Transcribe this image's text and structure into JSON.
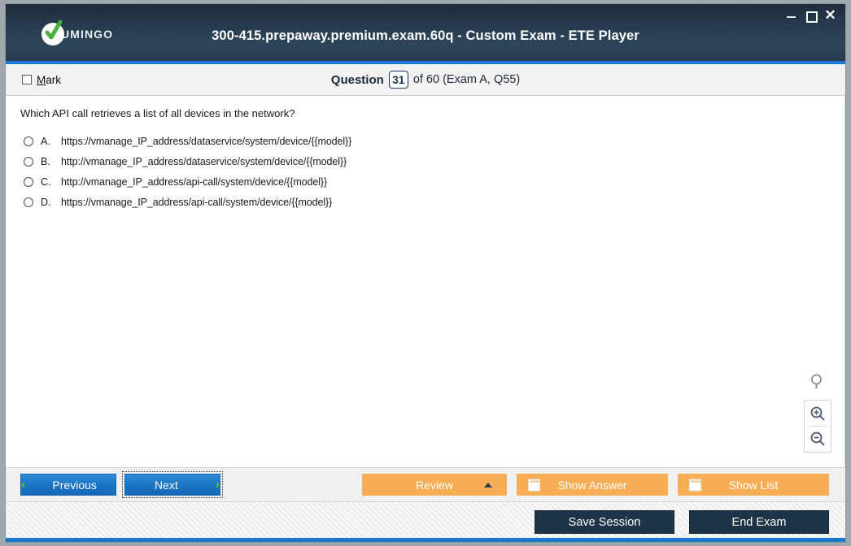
{
  "window": {
    "title": "300-415.prepaway.premium.exam.60q - Custom Exam - ETE Player",
    "logo_text": "UMINGO",
    "controls": {
      "minimize": "minimize",
      "maximize": "maximize",
      "close": "✕"
    },
    "accent_color": "#1976d2",
    "titlebar_color": "#253a4f"
  },
  "question_bar": {
    "mark_label_prefix": "M",
    "mark_label_rest": "ark",
    "question_word": "Question",
    "question_number": "31",
    "of_total": "of 60 (Exam A, Q55)"
  },
  "question": {
    "text": "Which API call retrieves a list of all devices in the network?",
    "options": [
      {
        "letter": "A.",
        "text": "https://vmanage_IP_address/dataservice/system/device/{{model}}",
        "selected": false
      },
      {
        "letter": "B.",
        "text": "http://vmanage_IP_address/dataservice/system/device/{{model}}",
        "selected": false
      },
      {
        "letter": "C.",
        "text": "http://vmanage_IP_address/api-call/system/device/{{model}}",
        "selected": false
      },
      {
        "letter": "D.",
        "text": "https://vmanage_IP_address/api-call/system/device/{{model}}",
        "selected": false
      }
    ]
  },
  "zoom_tools": {
    "search": "search-icon",
    "zoom_in": "zoom-in-icon",
    "zoom_out": "zoom-out-icon"
  },
  "toolbar": {
    "previous_label": "Previous",
    "next_label": "Next",
    "review_label": "Review",
    "show_answer_label": "Show Answer",
    "show_list_label": "Show List",
    "nav_button_color": "#1a73c4",
    "action_button_color": "#f8ae54"
  },
  "footer": {
    "save_session_label": "Save Session",
    "end_exam_label": "End Exam",
    "button_color": "#1e3448"
  }
}
